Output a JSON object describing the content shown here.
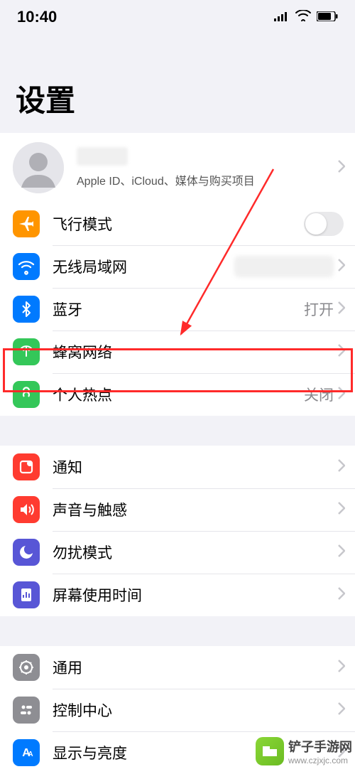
{
  "status": {
    "time": "10:40"
  },
  "title": "设置",
  "profile": {
    "subtitle": "Apple ID、iCloud、媒体与购买项目"
  },
  "groups": [
    [
      {
        "icon": "airplane",
        "color": "bg-orange",
        "label": "飞行模式",
        "control": "toggle"
      },
      {
        "icon": "wifi",
        "color": "bg-blue",
        "label": "无线局域网",
        "value_blur": true,
        "chevron": true
      },
      {
        "icon": "bluetooth",
        "color": "bg-blue",
        "label": "蓝牙",
        "value": "打开",
        "chevron": true
      },
      {
        "icon": "cellular",
        "color": "bg-green",
        "label": "蜂窝网络",
        "chevron": true,
        "highlight": true
      },
      {
        "icon": "hotspot",
        "color": "bg-green2",
        "label": "个人热点",
        "value": "关闭",
        "chevron": true
      }
    ],
    [
      {
        "icon": "notifications",
        "color": "bg-red",
        "label": "通知",
        "chevron": true
      },
      {
        "icon": "sound",
        "color": "bg-red2",
        "label": "声音与触感",
        "chevron": true
      },
      {
        "icon": "dnd",
        "color": "bg-purple",
        "label": "勿扰模式",
        "chevron": true
      },
      {
        "icon": "screentime",
        "color": "bg-indigo",
        "label": "屏幕使用时间",
        "chevron": true
      }
    ],
    [
      {
        "icon": "general",
        "color": "bg-gray",
        "label": "通用",
        "chevron": true
      },
      {
        "icon": "control-center",
        "color": "bg-gray",
        "label": "控制中心",
        "chevron": true
      },
      {
        "icon": "display",
        "color": "bg-blue2",
        "label": "显示与亮度",
        "chevron": true
      }
    ]
  ],
  "watermark": {
    "text": "铲子手游网",
    "url": "www.czjxjc.com"
  }
}
